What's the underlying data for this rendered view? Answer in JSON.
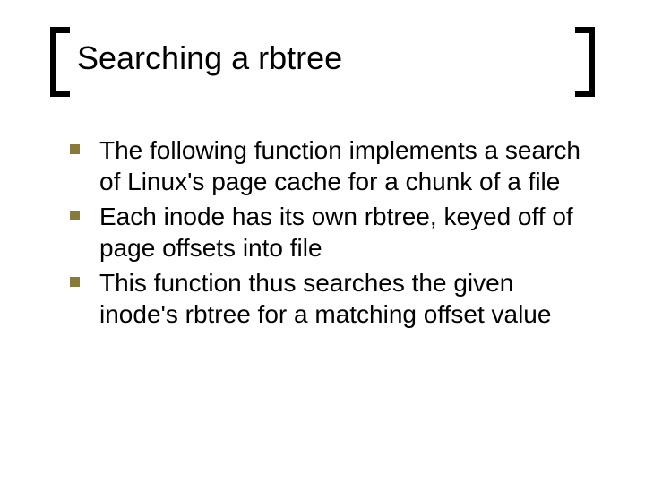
{
  "title": "Searching a rbtree",
  "bullets": [
    {
      "text": "The following function implements a search of Linux's page cache for a chunk of a file"
    },
    {
      "text": "Each inode has its own rbtree, keyed off of page offsets into file"
    },
    {
      "text": "This function thus searches the given inode's rbtree for a matching offset value"
    }
  ]
}
